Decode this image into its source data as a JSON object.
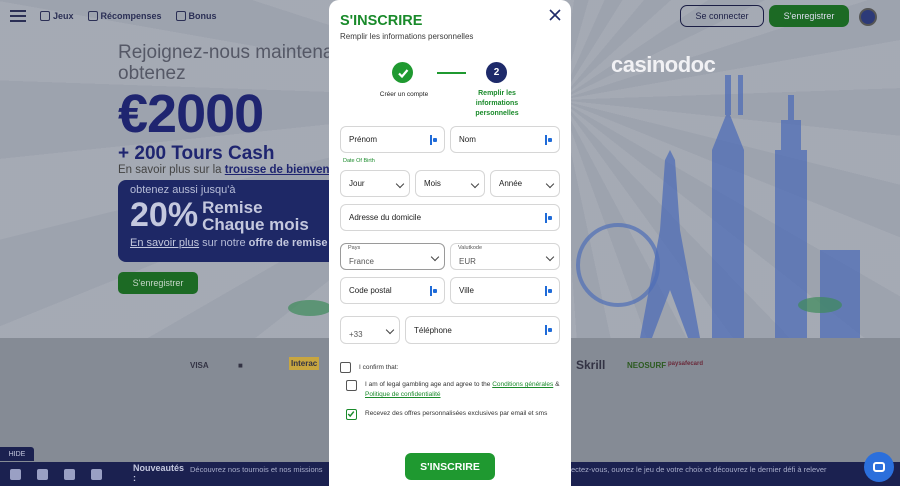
{
  "nav": {
    "items": [
      {
        "label": "Jeux"
      },
      {
        "label": "Récompenses"
      },
      {
        "label": "Bonus"
      }
    ],
    "login_label": "Se connecter",
    "register_label": "S'enregistrer"
  },
  "hero": {
    "line1": "Rejoignez-nous maintenant et",
    "line2": "obtenez",
    "amount": "€2000",
    "tours": "+ 200 Tours Cash",
    "kit_prefix": "En savoir plus sur la ",
    "kit_link": "trousse de bienvenue",
    "promo_line1": "obtenez aussi jusqu'à",
    "promo_pct": "20%",
    "promo_remise": "Remise",
    "promo_chaque": "Chaque mois",
    "promo_more_link": "En savoir plus",
    "promo_more_mid": " sur notre ",
    "promo_more_bold": "offre de remise",
    "register_label": "S'enregistrer"
  },
  "logo": {
    "text": "casinodoc"
  },
  "payments": [
    "VISA",
    "Interac",
    "Skrill",
    "NEOSURF",
    "paysafecard"
  ],
  "bottom": {
    "hide_label": "HIDE",
    "news_label": "Nouveautés",
    "news_colon": ":",
    "news_text": "Découvrez nos tournois et nos missions",
    "news_right": "ectez-vous, ouvrez le jeu de votre choix et découvrez le dernier défi à relever"
  },
  "modal": {
    "title": "S'INSCRIRE",
    "subtitle": "Remplir les informations personnelles",
    "step1_label": "Créer un compte",
    "step2_number": "2",
    "step2_label": "Remplir les informations personnelles",
    "fields": {
      "first_name": "Prénom",
      "last_name": "Nom",
      "dob_label": "Date Of Birth",
      "day": "Jour",
      "month": "Mois",
      "year": "Année",
      "address": "Adresse du domicile",
      "country_label": "Pays",
      "country_value": "France",
      "currency_label": "Valutkode",
      "currency_value": "EUR",
      "postal": "Code postal",
      "city": "Ville",
      "phone_code": "+33",
      "phone": "Téléphone"
    },
    "confirm_all": "I confirm that:",
    "terms_prefix": "I am of legal gambling age and agree to the ",
    "terms_link": "Conditions générales",
    "terms_mid": " & ",
    "privacy_link": "Politique de confidentialité",
    "offers_label": "Recevez des offres personnalisées exclusives par email et sms",
    "submit_label": "S'INSCRIRE"
  }
}
